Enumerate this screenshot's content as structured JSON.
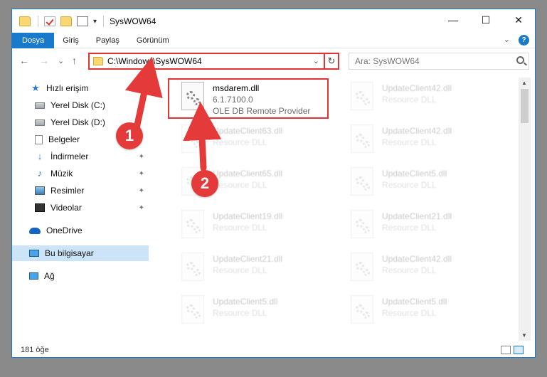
{
  "window": {
    "title": "SysWOW64",
    "controls": [
      "—",
      "☐",
      "✕"
    ],
    "quick_access_arrow": "▾"
  },
  "ribbon": {
    "tabs": [
      "Dosya",
      "Giriş",
      "Paylaş",
      "Görünüm"
    ],
    "active_tab": "Dosya",
    "expand_glyph": "⌄",
    "help_glyph": "?"
  },
  "nav": {
    "back_glyph": "←",
    "forward_glyph": "→",
    "recent_glyph": "⌄",
    "up_glyph": "↑",
    "address": "C:\\Windows\\SysWOW64",
    "address_drop": "⌄",
    "refresh_glyph": "↻",
    "search_placeholder": "Ara: SysWOW64"
  },
  "sidebar": {
    "items": [
      {
        "label": "Hızlı erişim",
        "icon": "star-icon"
      },
      {
        "label": "Yerel Disk (C:)",
        "icon": "drive-icon"
      },
      {
        "label": "Yerel Disk (D:)",
        "icon": "drive-icon"
      },
      {
        "label": "Belgeler",
        "icon": "documents-icon"
      },
      {
        "label": "İndirmeler",
        "icon": "downloads-icon"
      },
      {
        "label": "Müzik",
        "icon": "music-icon"
      },
      {
        "label": "Resimler",
        "icon": "pictures-icon"
      },
      {
        "label": "Videolar",
        "icon": "videos-icon"
      },
      {
        "label": "OneDrive",
        "icon": "cloud-icon"
      },
      {
        "label": "Bu bilgisayar",
        "icon": "computer-icon"
      },
      {
        "label": "Ağ",
        "icon": "network-icon"
      }
    ],
    "pin_glyph": "✦",
    "selected": "Bu bilgisayar"
  },
  "files": [
    {
      "name": "msdarem.dll",
      "version": "6.1.7100.0",
      "desc": "OLE DB Remote Provider"
    },
    {
      "name": "UpdateClient42.dll",
      "desc": "Resource DLL"
    },
    {
      "name": "UpdateClient63.dll",
      "desc": "Resource DLL"
    },
    {
      "name": "UpdateClient42.dll",
      "desc": "Resource DLL"
    },
    {
      "name": "UpdateClient65.dll",
      "desc": "Resource DLL"
    },
    {
      "name": "UpdateClient5.dll",
      "desc": "Resource DLL"
    },
    {
      "name": "UpdateClient19.dll",
      "desc": "Resource DLL"
    },
    {
      "name": "UpdateClient21.dll",
      "desc": "Resource DLL"
    },
    {
      "name": "UpdateClient21.dll",
      "desc": "Resource DLL"
    },
    {
      "name": "UpdateClient42.dll",
      "desc": "Resource DLL"
    },
    {
      "name": "UpdateClient5.dll",
      "desc": "Resource DLL"
    },
    {
      "name": "UpdateClient5.dll",
      "desc": "Resource DLL"
    }
  ],
  "status": {
    "count": "181 öğe"
  },
  "annotations": {
    "badge1": "1",
    "badge2": "2",
    "color": "#e53a3a"
  },
  "scroll": {
    "up": "▲",
    "down": "▼"
  }
}
